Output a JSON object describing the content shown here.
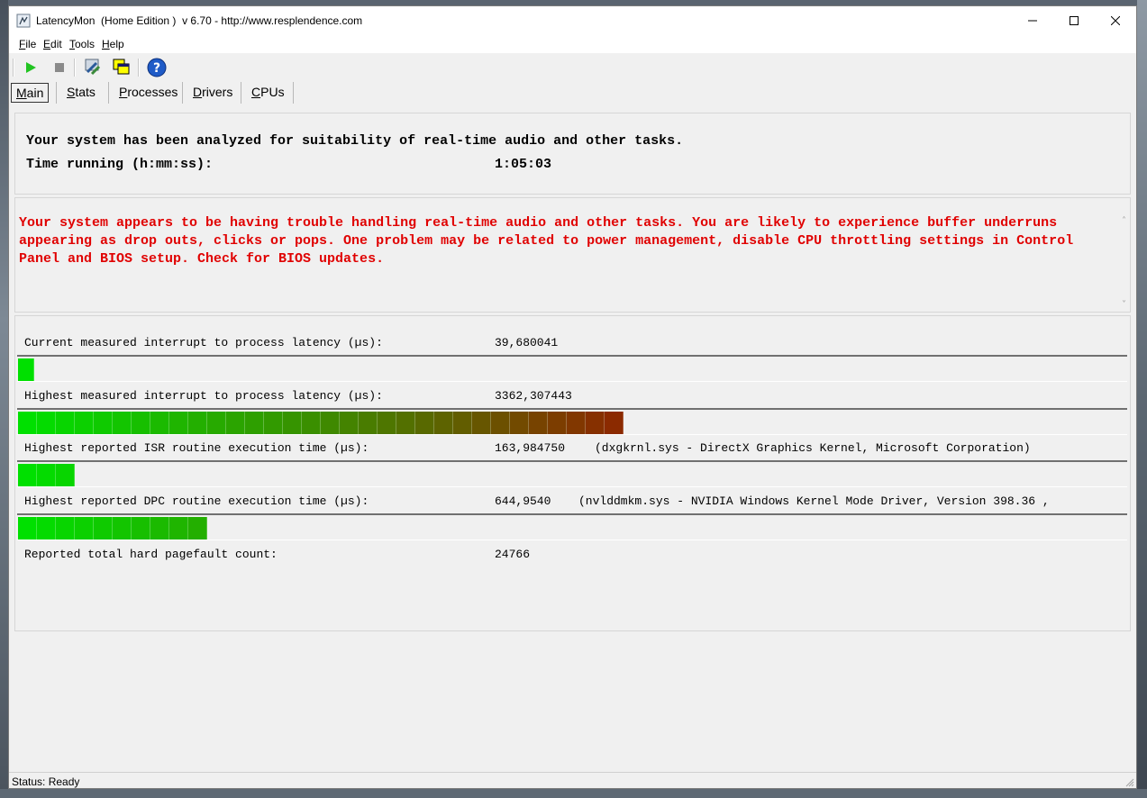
{
  "window": {
    "title": "LatencyMon  (Home Edition )  v 6.70 - http://www.resplendence.com"
  },
  "menu": [
    {
      "hot": "F",
      "rest": "ile"
    },
    {
      "hot": "E",
      "rest": "dit"
    },
    {
      "hot": "T",
      "rest": "ools"
    },
    {
      "hot": "H",
      "rest": "elp"
    }
  ],
  "toolbar": {
    "icons": [
      "play-icon",
      "stop-icon",
      "hammer-icon",
      "windows-icon",
      "help-icon"
    ]
  },
  "tabs": [
    {
      "hot": "M",
      "rest": "ain",
      "active": true
    },
    {
      "hot": "S",
      "rest": "tats",
      "active": false
    },
    {
      "hot": "P",
      "rest": "rocesses",
      "active": false
    },
    {
      "hot": "D",
      "rest": "rivers",
      "active": false
    },
    {
      "hot": "C",
      "rest": "PUs",
      "active": false
    }
  ],
  "summary": {
    "line1": "Your system has been analyzed for suitability of real-time audio and other tasks.",
    "time_label": "Time running (h:mm:ss):",
    "time_value": "1:05:03"
  },
  "warning": {
    "text": "Your system appears to be having trouble handling real-time audio and other tasks. You are likely to experience buffer underruns appearing as drop outs, clicks or pops. One problem may be related to power management, disable CPU throttling settings in Control Panel and BIOS setup. Check for BIOS updates."
  },
  "metrics": [
    {
      "label": "Current measured interrupt to process latency (µs):",
      "value": "39,680041",
      "extra": "",
      "segments": 1
    },
    {
      "label": "Highest measured interrupt to process latency (µs):",
      "value": "3362,307443",
      "extra": "",
      "segments": 32
    },
    {
      "label": "Highest reported ISR routine execution time (µs):",
      "value": "163,984750",
      "extra": "(dxgkrnl.sys - DirectX Graphics Kernel, Microsoft Corporation)",
      "segments": 3
    },
    {
      "label": "Highest reported DPC routine execution time (µs):",
      "value": "644,9540",
      "extra": "(nvlddmkm.sys - NVIDIA Windows Kernel Mode Driver, Version 398.36 ,",
      "segments": 10
    }
  ],
  "pagefault": {
    "label": "Reported total hard pagefault count:",
    "value": "24766"
  },
  "status": {
    "text": "Status: Ready"
  },
  "colors": {
    "warning_red": "#e00000",
    "bar_green": "#00e000",
    "bar_dark_red": "#8b2a00"
  }
}
